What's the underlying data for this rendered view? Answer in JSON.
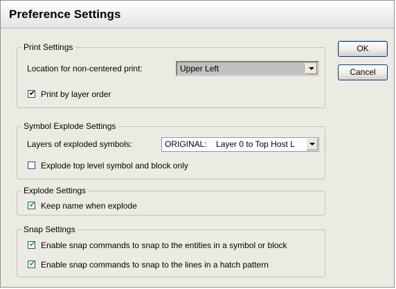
{
  "dialog": {
    "title": "Preference Settings"
  },
  "buttons": {
    "ok": "OK",
    "cancel": "Cancel"
  },
  "print_settings": {
    "legend": "Print Settings",
    "location_label": "Location for non-centered print:",
    "location_value": "Upper Left",
    "print_by_layer_label": "Print by layer order",
    "print_by_layer_checked": true
  },
  "symbol_explode": {
    "legend": "Symbol Explode Settings",
    "layers_label": "Layers of exploded symbols:",
    "layers_value": "ORIGINAL:    Layer 0 to Top Host L",
    "top_level_label": "Explode top level symbol and block only",
    "top_level_checked": false
  },
  "explode_settings": {
    "legend": "Explode Settings",
    "keep_name_label": "Keep name when explode",
    "keep_name_checked": true
  },
  "snap_settings": {
    "legend": "Snap Settings",
    "snap_symbol_label": "Enable snap commands to snap to the entities in a symbol or block",
    "snap_symbol_checked": true,
    "snap_hatch_label": "Enable snap commands to snap to the lines in a hatch pattern",
    "snap_hatch_checked": true
  }
}
